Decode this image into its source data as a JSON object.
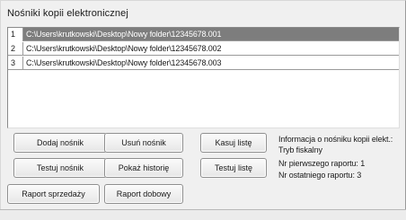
{
  "window": {
    "title": "Nośniki kopii elektronicznej"
  },
  "files_list": {
    "rows": [
      {
        "number": "1",
        "path": "C:\\Users\\krutkowski\\Desktop\\Nowy folder\\12345678.001",
        "selected": true
      },
      {
        "number": "2",
        "path": "C:\\Users\\krutkowski\\Desktop\\Nowy folder\\12345678.002",
        "selected": false
      },
      {
        "number": "3",
        "path": "C:\\Users\\krutkowski\\Desktop\\Nowy folder\\12345678.003",
        "selected": false
      }
    ]
  },
  "buttons": {
    "add_medium": "Dodaj nośnik",
    "remove_medium": "Usuń nośnik",
    "clear_list": "Kasuj listę",
    "test_medium": "Testuj nośnik",
    "show_history": "Pokaż historię",
    "test_list": "Testuj listę",
    "sales_report": "Raport sprzedaży",
    "daily_report": "Raport dobowy"
  },
  "medium_info": {
    "heading": "Informacja o nośniku kopii elekt.:",
    "mode": "Tryb fiskalny",
    "first_report": "Nr pierwszego raportu: 1",
    "last_report": "Nr ostatniego raportu: 3"
  },
  "colors": {
    "window_background": "#f0f0f0",
    "selected_row": "#7d7d7d",
    "list_background": "#ffffff"
  }
}
